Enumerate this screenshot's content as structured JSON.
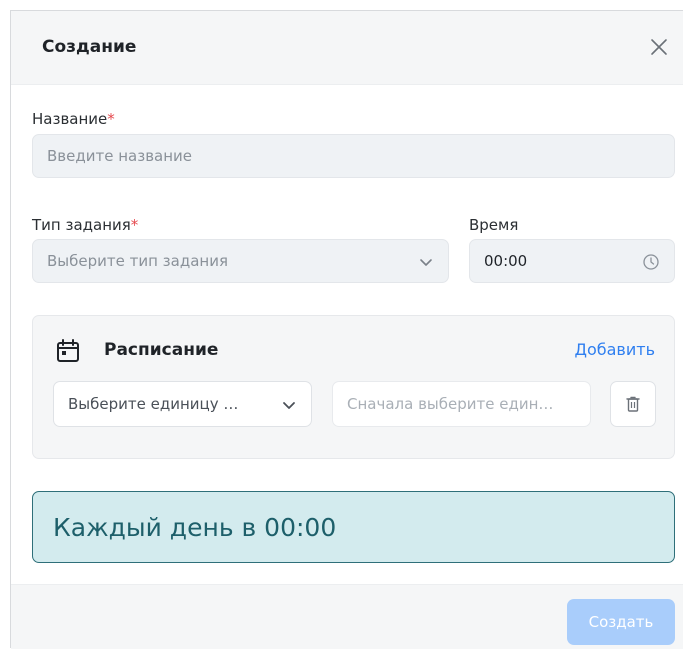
{
  "dialog": {
    "title": "Создание"
  },
  "form": {
    "name": {
      "label": "Название",
      "required_mark": "*",
      "placeholder": "Введите название"
    },
    "task_type": {
      "label": "Тип задания",
      "required_mark": "*",
      "placeholder": "Выберите тип задания"
    },
    "time": {
      "label": "Время",
      "value": "00:00"
    }
  },
  "schedule": {
    "title": "Расписание",
    "add_label": "Добавить",
    "unit_placeholder": "Выберите единицу …",
    "value_placeholder": "Сначала выберите един…"
  },
  "summary": {
    "text": "Каждый день в 00:00"
  },
  "footer": {
    "create_label": "Создать"
  },
  "icons": {
    "close": "close-icon",
    "chevron": "chevron-down-icon",
    "clock": "clock-icon",
    "calendar": "calendar-icon",
    "trash": "trash-icon"
  },
  "colors": {
    "accent": "#2f7ff0",
    "required": "#e5484d",
    "summary_bg": "#d3ebee",
    "summary_border": "#2e6f79",
    "create_disabled": "#a9cdfb"
  }
}
